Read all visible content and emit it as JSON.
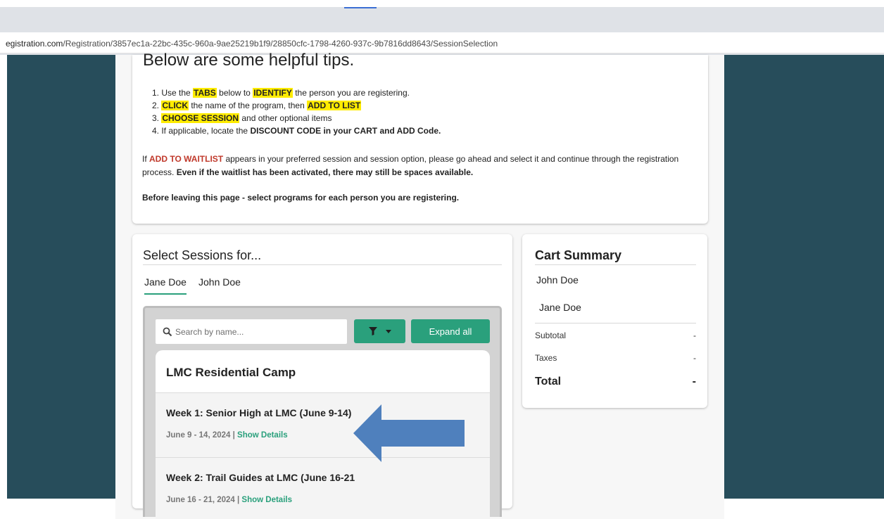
{
  "browser": {
    "url_host": "egistration.com",
    "url_path": "/Registration/3857ec1a-22bc-435c-960a-9ae25219b1f9/28850cfc-1798-4260-937c-9b7816dd8643/SessionSelection"
  },
  "tips": {
    "heading": "Below are some helpful tips.",
    "items": [
      {
        "n": "1. Use the ",
        "hl1": "TABS",
        "mid": " below to ",
        "hl2": "IDENTIFY",
        "end": " the person you are registering."
      },
      {
        "n": "2. ",
        "hl1": "CLICK",
        "mid": " the name of the program, then ",
        "hl2": "ADD TO LIST",
        "end": ""
      },
      {
        "n": "3. ",
        "hl1": "CHOOSE SESSION",
        "mid": " and other optional items",
        "hl2": "",
        "end": ""
      },
      {
        "n": "4. If applicable, locate the ",
        "bold": "DISCOUNT CODE in your CART and ADD Code."
      }
    ],
    "waitlist_prefix": "If ",
    "waitlist_red": "ADD TO WAITLIST",
    "waitlist_text": " appears in your preferred session and session option, please go ahead and select it and continue through the registration process. ",
    "waitlist_bold": "Even if the waitlist has been activated, there may still be spaces available.",
    "before_leaving": "Before leaving this page - select programs for each person you are registering."
  },
  "sessions": {
    "title": "Select Sessions for...",
    "person_tabs": [
      "Jane Doe",
      "John Doe"
    ],
    "search_placeholder": "Search by name...",
    "expand_label": "Expand all",
    "program_title": "LMC Residential Camp",
    "items": [
      {
        "name": "Week 1: Senior High at LMC (June 9-14)",
        "date": "June 9 - 14, 2024",
        "sep": " | ",
        "details": "Show Details"
      },
      {
        "name": "Week 2: Trail Guides at LMC (June 16-21",
        "date": "June 16 - 21, 2024",
        "sep": " | ",
        "details": "Show Details"
      }
    ]
  },
  "cart": {
    "title": "Cart Summary",
    "people": [
      "John Doe",
      "Jane Doe"
    ],
    "subtotal_label": "Subtotal",
    "subtotal_value": "-",
    "taxes_label": "Taxes",
    "taxes_value": "-",
    "total_label": "Total",
    "total_value": "-"
  },
  "colors": {
    "accent": "#2aa07c",
    "sidebar": "#274d5b",
    "highlight": "#ffec00",
    "arrow": "#4f80bd"
  },
  "icons": {
    "search": "search-icon",
    "filter": "filter-icon",
    "caret": "caret-down-icon",
    "arrow": "arrow-left-icon"
  }
}
